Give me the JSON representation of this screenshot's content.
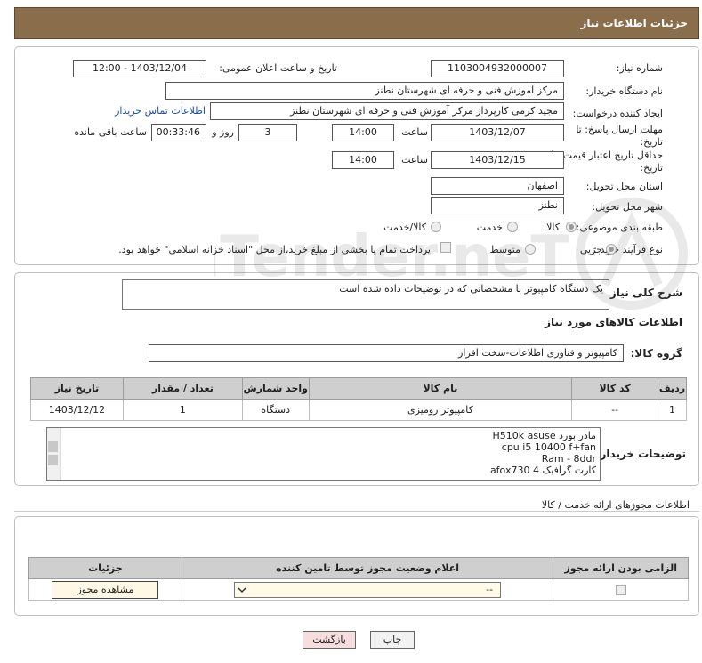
{
  "header": {
    "title": "جزئیات اطلاعات نیاز"
  },
  "form": {
    "need_number_label": "شماره نیاز:",
    "need_number": "1103004932000007",
    "announce_label": "تاریخ و ساعت اعلان عمومی:",
    "announce_value": "1403/12/04 - 12:00",
    "buyer_org_label": "نام دستگاه خریدار:",
    "buyer_org": "مرکز آموزش فنی و حرفه ای شهرستان نطنز",
    "requester_label": "ایجاد کننده درخواست:",
    "requester": "مجید کرمی کارپرداز مرکز آموزش فنی و حرفه ای شهرستان نطنز",
    "contact_link": "اطلاعات تماس خریدار",
    "deadline_label_1": "مهلت ارسال پاسخ: تا",
    "deadline_label_2": "تاریخ:",
    "deadline_date": "1403/12/07",
    "time_label": "ساعت",
    "deadline_time": "14:00",
    "days_value": "3",
    "days_label": "روز و",
    "remaining_value": "00:33:46",
    "remaining_label": "ساعت باقی مانده",
    "validity_label_1": "حداقل تاریخ اعتبار قیمت: تا",
    "validity_label_2": "تاریخ:",
    "validity_date": "1403/12/15",
    "validity_time": "14:00",
    "province_label": "استان محل تحویل:",
    "province": "اصفهان",
    "city_label": "شهر محل تحویل:",
    "city": "نطنز",
    "category_label": "طبقه بندی موضوعی:",
    "category_options": [
      "کالا",
      "خدمت",
      "کالا/خدمت"
    ],
    "purchase_label": "نوع فرآیند خرید :",
    "purchase_options": [
      "جزیی",
      "متوسط"
    ],
    "payment_note": "پرداخت تمام یا بخشی از مبلغ خرید،از محل \"اسناد خزانه اسلامی\" خواهد بود."
  },
  "description": {
    "label": "شرح کلی نیاز:",
    "text": "یک دستگاه کامپیوتر با مشخصاتی که در توضیحات داده شده است"
  },
  "goods": {
    "section_title": "اطلاعات کالاهای مورد نیاز",
    "group_label": "گروه کالا:",
    "group_value": "کامپیوتر و فناوری اطلاعات-سخت افزار",
    "columns": [
      "ردیف",
      "کد کالا",
      "نام کالا",
      "واحد شمارش",
      "تعداد / مقدار",
      "تاریخ نیاز"
    ],
    "rows": [
      [
        "1",
        "--",
        "کامپیوتر رومیزی",
        "دستگاه",
        "1",
        "1403/12/12"
      ]
    ],
    "buyer_notes_label": "توضیحات خریدار:",
    "buyer_notes": [
      "مادر بورد H510k asuse",
      "cpu i5 10400 f+fan",
      "Ram - 8ddr",
      "کارت گرافیک afox730 4"
    ]
  },
  "permits": {
    "section_title": "اطلاعات مجوزهای ارائه خدمت / کالا",
    "columns": [
      "الزامی بودن ارائه مجوز",
      "اعلام وضعیت مجوز توسط تامین کننده",
      "جزئیات"
    ],
    "select_value": "--",
    "view_button": "مشاهده مجوز"
  },
  "footer": {
    "print_button": "چاپ",
    "back_button": "بازگشت"
  },
  "watermark": {
    "text": "AriaTender.neT"
  },
  "colors": {
    "title_bg": "#8a6d4b",
    "back_button_bg": "#f7dede",
    "link": "#1a4ea8"
  }
}
